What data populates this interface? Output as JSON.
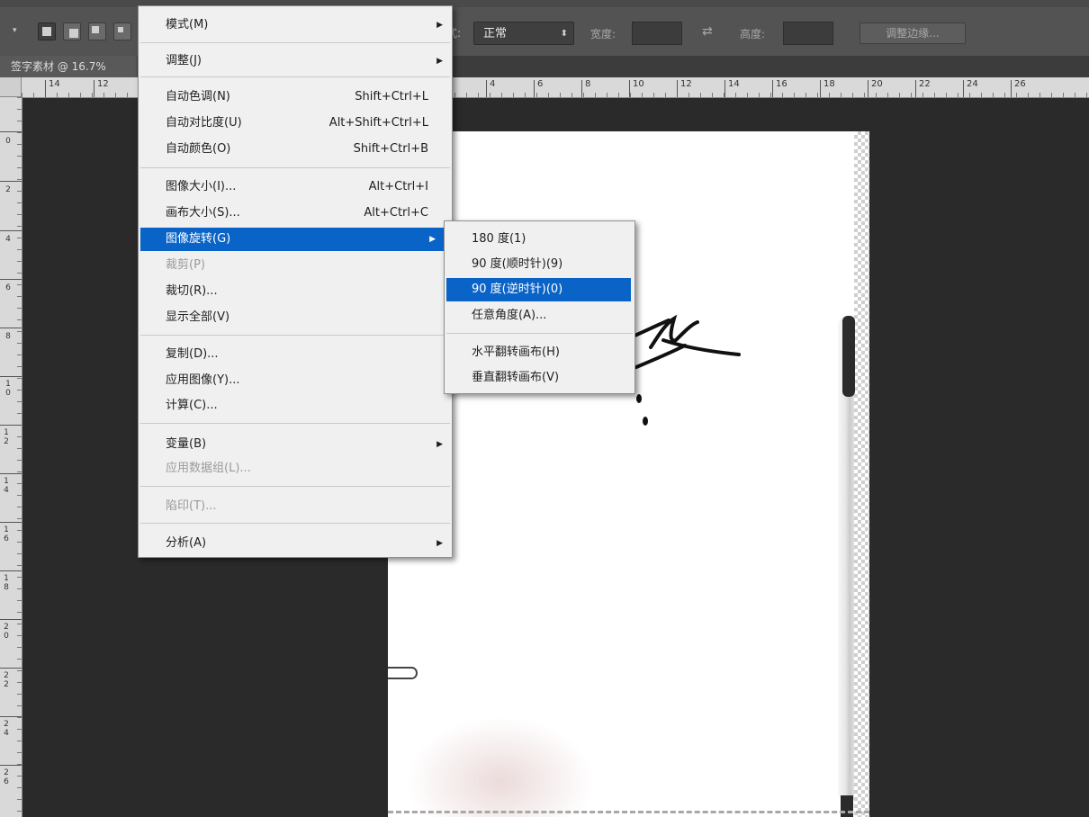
{
  "document_tab": {
    "title": "签字素材 @ 16.7%"
  },
  "options_bar": {
    "style_label": "式:",
    "style_value": "正常",
    "width_label": "宽度:",
    "height_label": "高度:",
    "refine_edge_button": "调整边缘..."
  },
  "rulers": {
    "horizontal_ticks": [
      "14",
      "12",
      "4",
      "6",
      "8",
      "10",
      "12",
      "14",
      "16",
      "18",
      "20",
      "22",
      "24",
      "26"
    ],
    "vertical_ticks": [
      "0",
      "2",
      "4",
      "6",
      "8",
      "10",
      "12",
      "14",
      "16",
      "18",
      "20",
      "22",
      "24",
      "26"
    ]
  },
  "image_menu": {
    "items": [
      {
        "label": "模式(M)",
        "shortcut": "",
        "submenu": true,
        "disabled": false
      },
      {
        "label": "调整(J)",
        "shortcut": "",
        "submenu": true,
        "disabled": false
      },
      {
        "label": "自动色调(N)",
        "shortcut": "Shift+Ctrl+L",
        "submenu": false,
        "disabled": false
      },
      {
        "label": "自动对比度(U)",
        "shortcut": "Alt+Shift+Ctrl+L",
        "submenu": false,
        "disabled": false
      },
      {
        "label": "自动颜色(O)",
        "shortcut": "Shift+Ctrl+B",
        "submenu": false,
        "disabled": false
      },
      {
        "label": "图像大小(I)...",
        "shortcut": "Alt+Ctrl+I",
        "submenu": false,
        "disabled": false
      },
      {
        "label": "画布大小(S)...",
        "shortcut": "Alt+Ctrl+C",
        "submenu": false,
        "disabled": false
      },
      {
        "label": "图像旋转(G)",
        "shortcut": "",
        "submenu": true,
        "disabled": false
      },
      {
        "label": "裁剪(P)",
        "shortcut": "",
        "submenu": false,
        "disabled": true
      },
      {
        "label": "裁切(R)...",
        "shortcut": "",
        "submenu": false,
        "disabled": false
      },
      {
        "label": "显示全部(V)",
        "shortcut": "",
        "submenu": false,
        "disabled": false
      },
      {
        "label": "复制(D)...",
        "shortcut": "",
        "submenu": false,
        "disabled": false
      },
      {
        "label": "应用图像(Y)...",
        "shortcut": "",
        "submenu": false,
        "disabled": false
      },
      {
        "label": "计算(C)...",
        "shortcut": "",
        "submenu": false,
        "disabled": false
      },
      {
        "label": "变量(B)",
        "shortcut": "",
        "submenu": true,
        "disabled": false
      },
      {
        "label": "应用数据组(L)...",
        "shortcut": "",
        "submenu": false,
        "disabled": true
      },
      {
        "label": "陷印(T)...",
        "shortcut": "",
        "submenu": false,
        "disabled": true
      },
      {
        "label": "分析(A)",
        "shortcut": "",
        "submenu": true,
        "disabled": false
      }
    ],
    "highlighted": "图像旋转(G)"
  },
  "rotation_submenu": {
    "items": [
      {
        "label": "180 度(1)"
      },
      {
        "label": "90 度(顺时针)(9)"
      },
      {
        "label": "90 度(逆时针)(0)"
      },
      {
        "label": "任意角度(A)..."
      },
      {
        "label": "水平翻转画布(H)"
      },
      {
        "label": "垂直翻转画布(V)"
      }
    ],
    "highlighted": "90 度(逆时针)(0)"
  },
  "colors": {
    "menu_highlight": "#0a64c8",
    "workspace": "#2a2a2a",
    "menu_background": "#f0f0f0"
  }
}
